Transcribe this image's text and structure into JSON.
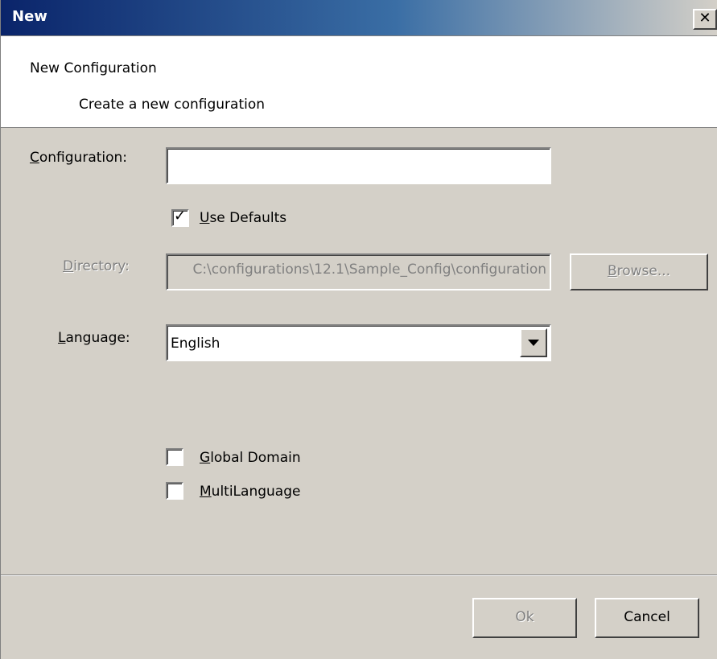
{
  "window": {
    "title": "New",
    "close_glyph": "✕"
  },
  "header": {
    "title": "New Configuration",
    "subtitle": "Create a new configuration"
  },
  "form": {
    "configuration": {
      "label_prefix": "",
      "label_mnemonic": "C",
      "label_rest": "onfiguration:",
      "value": ""
    },
    "use_defaults": {
      "mnemonic": "U",
      "rest": "se Defaults",
      "checked": true
    },
    "directory": {
      "label_mnemonic": "D",
      "label_rest": "irectory:",
      "value": "C:\\configurations\\12.1\\Sample_Config\\configuration",
      "disabled": true
    },
    "browse_button": {
      "mnemonic": "B",
      "rest": "rowse...",
      "disabled": true
    },
    "language": {
      "label_mnemonic": "L",
      "label_rest": "anguage:",
      "selected": "English"
    },
    "global_domain": {
      "mnemonic": "G",
      "rest": "lobal Domain",
      "checked": false
    },
    "multilanguage": {
      "mnemonic": "M",
      "rest": "ultiLanguage",
      "checked": false
    }
  },
  "footer": {
    "ok_label": "Ok",
    "ok_disabled": true,
    "cancel_label": "Cancel"
  },
  "icons": {
    "close": "close-icon",
    "dropdown": "chevron-down-icon",
    "check": "check-icon"
  },
  "colors": {
    "titlebar_start": "#0a246a",
    "titlebar_end": "#d4d0c8",
    "face": "#d4d0c8",
    "disabled_text": "#808080"
  }
}
